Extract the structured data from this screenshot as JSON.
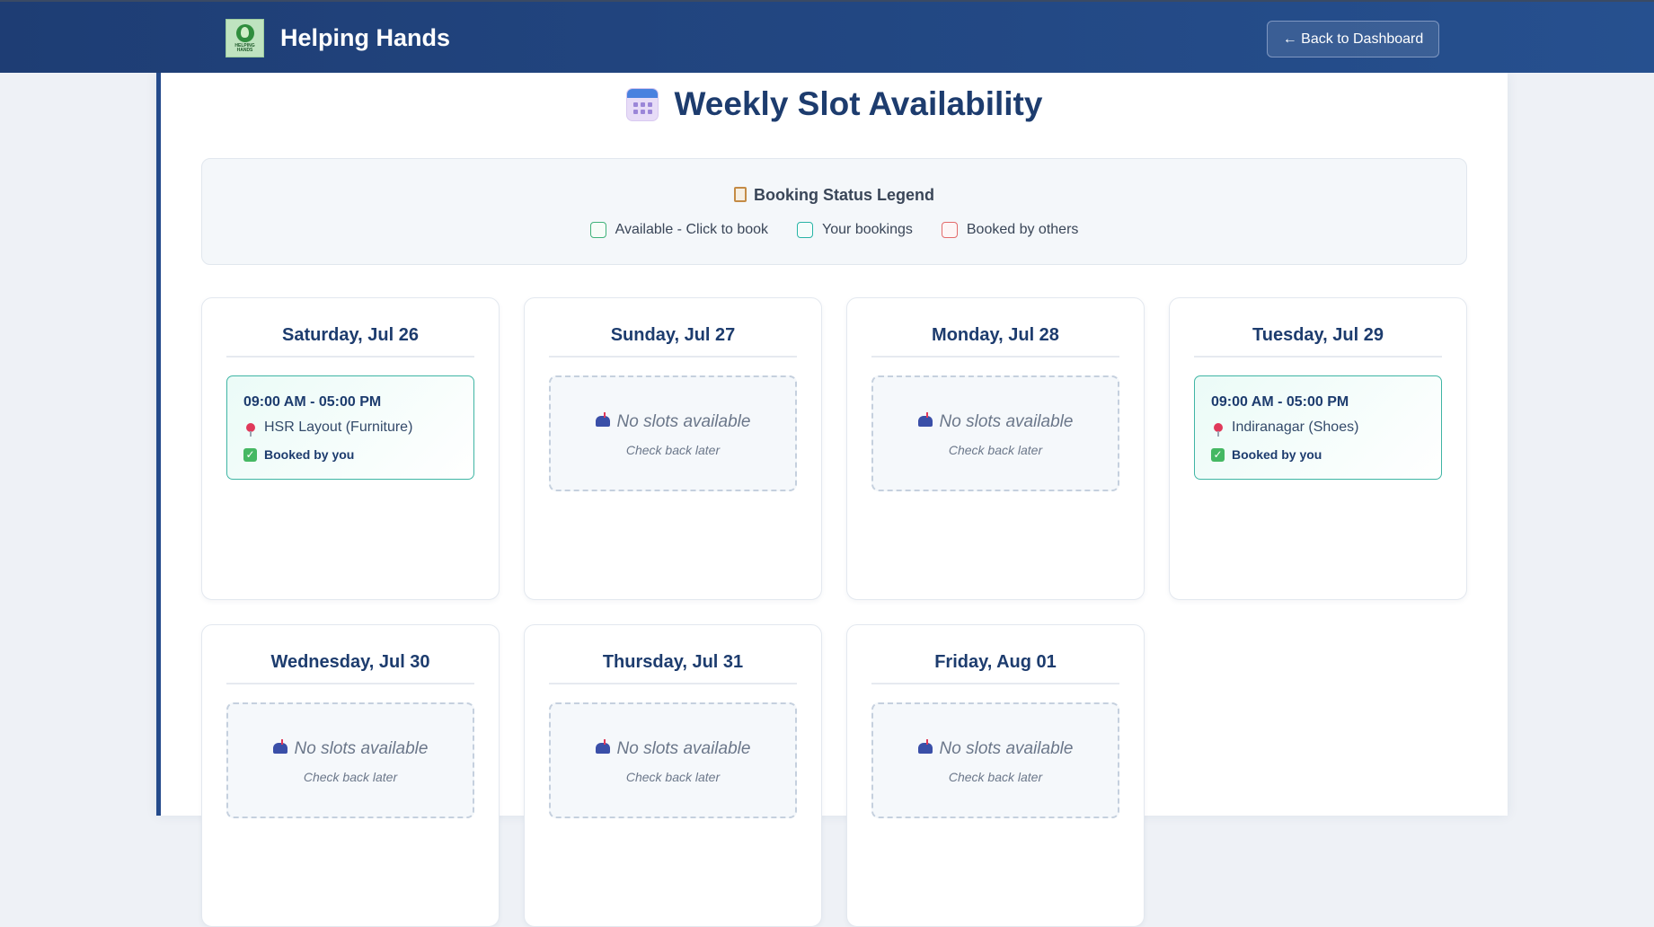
{
  "header": {
    "logo_text": "HELPING HANDS",
    "brand": "Helping Hands",
    "back_label": "← Back to Dashboard"
  },
  "page": {
    "title": "Weekly Slot Availability",
    "title_icon": "calendar-icon"
  },
  "legend": {
    "title": "Booking Status Legend",
    "items": [
      {
        "label": "Available - Click to book",
        "color": "#3fb27a"
      },
      {
        "label": "Your bookings",
        "color": "#27b4a6"
      },
      {
        "label": "Booked by others",
        "color": "#e36b6b"
      }
    ]
  },
  "empty_text": {
    "main": "No slots available",
    "sub": "Check back later"
  },
  "days": [
    {
      "title": "Saturday, Jul 26",
      "slot": {
        "time": "09:00 AM - 05:00 PM",
        "location": "HSR Layout (Furniture)",
        "status": "Booked by you"
      }
    },
    {
      "title": "Sunday, Jul 27"
    },
    {
      "title": "Monday, Jul 28"
    },
    {
      "title": "Tuesday, Jul 29",
      "slot": {
        "time": "09:00 AM - 05:00 PM",
        "location": "Indiranagar (Shoes)",
        "status": "Booked by you"
      }
    },
    {
      "title": "Wednesday, Jul 30"
    },
    {
      "title": "Thursday, Jul 31"
    },
    {
      "title": "Friday, Aug 01"
    }
  ]
}
